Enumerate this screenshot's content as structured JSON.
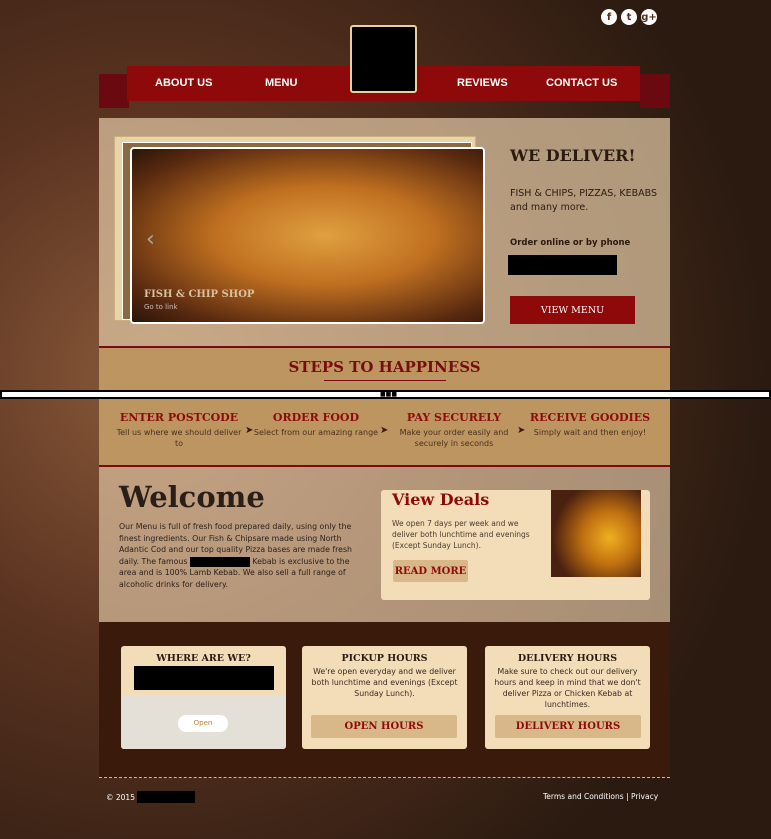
{
  "social": {
    "icons": [
      "facebook-icon",
      "twitter-icon",
      "google-plus-icon"
    ]
  },
  "nav": {
    "items": [
      "ABOUT US",
      "MENU",
      "REVIEWS",
      "CONTACT US"
    ]
  },
  "hero": {
    "slide_title": "FISH & CHIP SHOP",
    "slide_link": "Go to link",
    "heading": "WE DELIVER!",
    "subtext": "FISH & CHIPS, PIZZAS, KEBABS and many more.",
    "order_text": "Order online or by phone",
    "button": "VIEW MENU"
  },
  "steps": {
    "title": "STEPS TO HAPPINESS",
    "items": [
      {
        "title": "ENTER POSTCODE",
        "text": "Tell us where we should deliver to"
      },
      {
        "title": "ORDER FOOD",
        "text": "Select from our amazing range"
      },
      {
        "title": "PAY SECURELY",
        "text": "Make your order easily and securely in seconds"
      },
      {
        "title": "RECEIVE GOODIES",
        "text": "Simply wait and then enjoy!"
      }
    ]
  },
  "welcome": {
    "title": "Welcome",
    "text_a": "Our Menu is full of fresh food prepared daily, using only the finest ingredients. Our Fish & Chipsare made using North Adantic Cod and our top quality Pizza bases are made fresh daily. The famous",
    "text_b": "Kebab is exclusive to the area and is 100% Lamb Kebab. We also sell a full range of alcoholic drinks for delivery."
  },
  "deals": {
    "title": "View Deals",
    "text": "We open 7 days per week and we deliver both lunchtime and evenings (Except Sunday Lunch).",
    "button": "READ MORE"
  },
  "footer": {
    "where": {
      "title": "WHERE ARE WE?",
      "map_button": "Open"
    },
    "pickup": {
      "title": "PICKUP HOURS",
      "text": "We're open everyday and we deliver both lunchtime and evenings (Except Sunday Lunch).",
      "button": "OPEN HOURS"
    },
    "delivery": {
      "title": "DELIVERY HOURS",
      "text": "Make sure to check out our delivery hours and keep in mind that we don't deliver Pizza or Chicken Kebab at lunchtimes.",
      "button": "DELIVERY HOURS"
    }
  },
  "bottom": {
    "copyright": "© 2015",
    "terms": "Terms and Conditions",
    "sep": "|",
    "privacy": "Privacy"
  }
}
